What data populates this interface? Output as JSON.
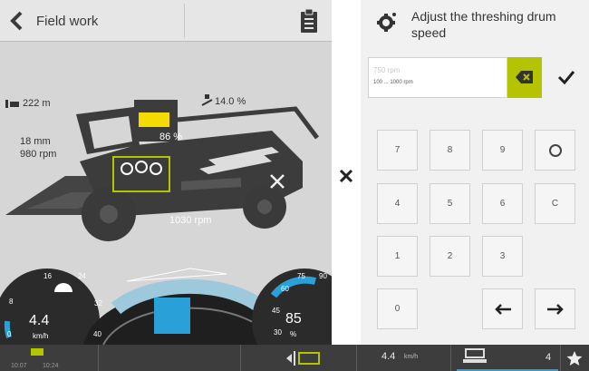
{
  "header": {
    "title": "Field work"
  },
  "machine": {
    "distance": "222 m",
    "slope": "14.0 %",
    "concave_gap": "18 mm",
    "rotor_speed": "980 rpm",
    "grain_tank": "86 %",
    "drum_speed_display": "1030 rpm"
  },
  "dashboard": {
    "speed_scale": [
      "8",
      "16",
      "24",
      "32",
      "40",
      "0"
    ],
    "speed_value": "4.4",
    "speed_unit": "km/h",
    "engine_scale": [
      "75",
      "90",
      "60",
      "45",
      "30"
    ],
    "engine_value": "85",
    "engine_unit": "%"
  },
  "keypad_panel": {
    "heading": "Adjust the threshing drum speed",
    "input_placeholder": "750 rpm",
    "range_hint": "100 ... 1000 rpm",
    "keys": [
      "7",
      "8",
      "9",
      "4",
      "5",
      "6",
      "C",
      "1",
      "2",
      "3",
      "0"
    ]
  },
  "statusbar": {
    "time_left": "10:07",
    "time_right": "10:24",
    "speed": "4.4",
    "speed_unit": "km/h",
    "count": "4"
  },
  "colors": {
    "accent": "#b5c400",
    "tank_yellow": "#f4dc00",
    "gauge_blue": "#2aa0d8",
    "panel_bg": "#f1f1f1",
    "machine_bg": "#d6d6d6"
  }
}
